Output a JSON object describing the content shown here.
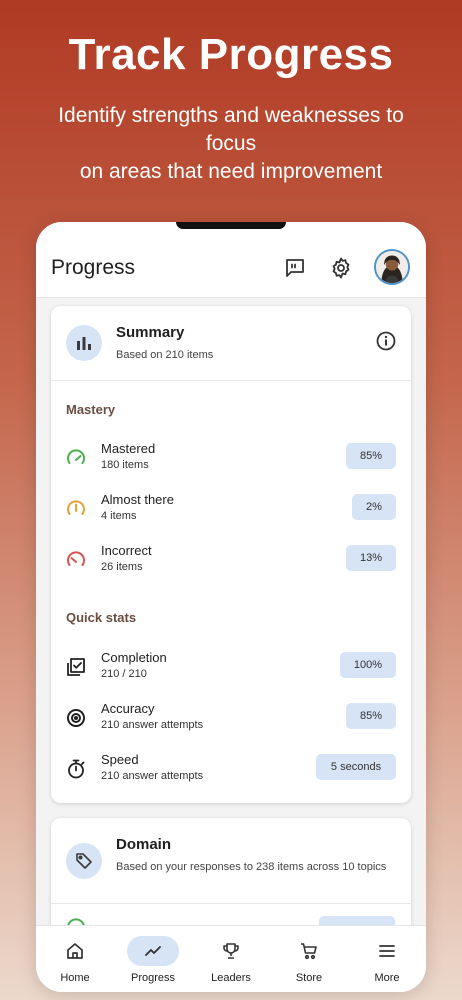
{
  "hero": {
    "title": "Track Progress",
    "subtitle_line1": "Identify strengths and weaknesses to",
    "subtitle_line2": "focus",
    "subtitle_line3": "on areas that need improvement"
  },
  "appbar": {
    "title": "Progress",
    "icons": [
      "feedback-icon",
      "settings-icon",
      "avatar"
    ]
  },
  "summary": {
    "title": "Summary",
    "subtitle": "Based on 210 items",
    "mastery_label": "Mastery",
    "mastery": [
      {
        "label": "Mastered",
        "sub": "180 items",
        "value": "85%",
        "color": "#4caf50"
      },
      {
        "label": "Almost there",
        "sub": "4 items",
        "value": "2%",
        "color": "#e6a23c"
      },
      {
        "label": "Incorrect",
        "sub": "26 items",
        "value": "13%",
        "color": "#d9534f"
      }
    ],
    "quick_stats_label": "Quick stats",
    "quick_stats": [
      {
        "label": "Completion",
        "sub": "210 / 210",
        "value": "100%"
      },
      {
        "label": "Accuracy",
        "sub": "210 answer attempts",
        "value": "85%"
      },
      {
        "label": "Speed",
        "sub": "210 answer attempts",
        "value": "5 seconds"
      }
    ]
  },
  "domain": {
    "title": "Domain",
    "subtitle": "Based on your responses to 238 items across 10 topics"
  },
  "nav": [
    {
      "label": "Home",
      "icon": "home-icon",
      "active": false
    },
    {
      "label": "Progress",
      "icon": "trend-icon",
      "active": true
    },
    {
      "label": "Leaders",
      "icon": "trophy-icon",
      "active": false
    },
    {
      "label": "Store",
      "icon": "cart-icon",
      "active": false
    },
    {
      "label": "More",
      "icon": "menu-icon",
      "active": false
    }
  ],
  "colors": {
    "accent_light": "#d6e4f5",
    "section_label": "#6a4e44",
    "background_top": "#b03a24"
  }
}
